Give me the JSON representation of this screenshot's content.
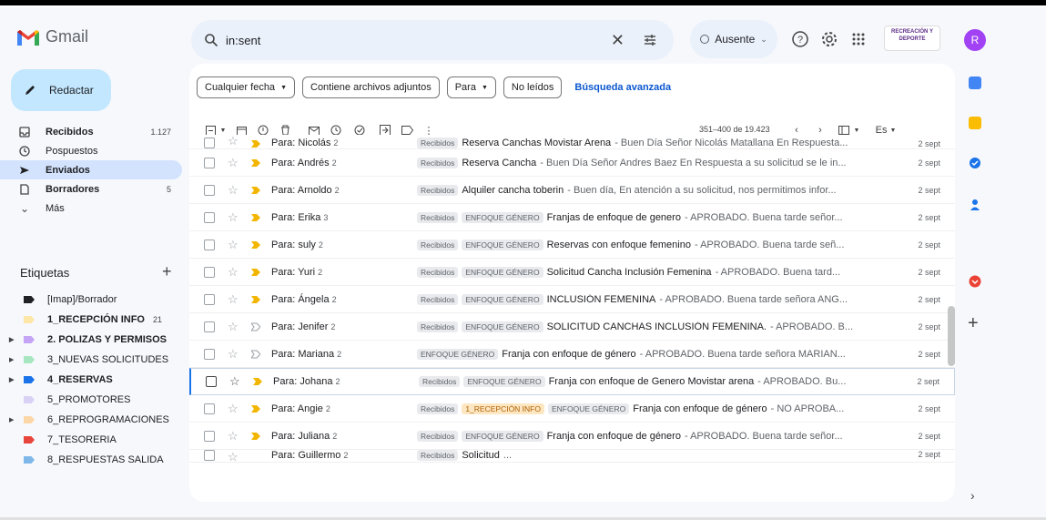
{
  "app": {
    "name": "Gmail"
  },
  "search": {
    "query": "in:sent",
    "clear_icon": "close-icon",
    "filter_icon": "tune-icon"
  },
  "status": {
    "label": "Ausente"
  },
  "header_icons": [
    "help-icon",
    "settings-icon",
    "apps-icon"
  ],
  "org_logo": {
    "text": "RECREACIÓN Y DEPORTE"
  },
  "avatar": {
    "initial": "R",
    "color": "#a142f4"
  },
  "compose": {
    "label": "Redactar"
  },
  "nav": {
    "items": [
      {
        "label": "Recibidos",
        "count": "1.127",
        "icon": "inbox-icon",
        "bold": true
      },
      {
        "label": "Pospuestos",
        "count": "",
        "icon": "clock-icon",
        "bold": false
      },
      {
        "label": "Enviados",
        "count": "",
        "icon": "send-icon",
        "bold": true,
        "active": true
      },
      {
        "label": "Borradores",
        "count": "5",
        "icon": "draft-icon",
        "bold": true
      },
      {
        "label": "Más",
        "count": "",
        "icon": "chevron-down-icon",
        "bold": false
      }
    ]
  },
  "labels": {
    "heading": "Etiquetas",
    "items": [
      {
        "label": "[Imap]/Borrador",
        "color": "#202124",
        "count": "",
        "caret": false,
        "bold": false
      },
      {
        "label": "1_RECEPCIÓN INFO",
        "color": "#fde7a6",
        "count": "21",
        "caret": false,
        "bold": true
      },
      {
        "label": "2. POLIZAS Y PERMISOS",
        "color": "#c5a3f5",
        "count": "",
        "caret": true,
        "bold": true
      },
      {
        "label": "3_NUEVAS SOLICITUDES",
        "color": "#a8e6c1",
        "count": "",
        "caret": true,
        "bold": false
      },
      {
        "label": "4_RESERVAS",
        "color": "#1a73e8",
        "count": "",
        "caret": true,
        "bold": true
      },
      {
        "label": "5_PROMOTORES",
        "color": "#d9d2f5",
        "count": "",
        "caret": false,
        "bold": false
      },
      {
        "label": "6_REPROGRAMACIONES",
        "color": "#fbd7a8",
        "count": "",
        "caret": true,
        "bold": false
      },
      {
        "label": "7_TESORERIA",
        "color": "#e8453c",
        "count": "",
        "caret": false,
        "bold": false
      },
      {
        "label": "8_RESPUESTAS SALIDA",
        "color": "#7fb8e8",
        "count": "",
        "caret": false,
        "bold": false
      }
    ]
  },
  "filters": {
    "chips": [
      "Cualquier fecha",
      "Contiene archivos adjuntos",
      "Para",
      "No leídos"
    ],
    "advanced": "Búsqueda avanzada"
  },
  "toolbar": {
    "pager": "351–400 de 19.423",
    "input_tool": "Es"
  },
  "emails": [
    {
      "from": "Para: Nicolás",
      "count": "2",
      "tags": [
        "Recibidos"
      ],
      "subject": "Reserva Canchas Movistar Arena",
      "snippet": " - Buen Día Señor Nicolás Matallana En Respuesta...",
      "date": "2 sept",
      "cut": true
    },
    {
      "from": "Para: Andrés",
      "count": "2",
      "tags": [
        "Recibidos"
      ],
      "subject": "Reserva Cancha",
      "snippet": " - Buen Día Señor Andres Baez En Respuesta a su solicitud se le in...",
      "date": "2 sept"
    },
    {
      "from": "Para: Arnoldo",
      "count": "2",
      "tags": [
        "Recibidos"
      ],
      "subject": "Alquiler cancha toberin",
      "snippet": " - Buen día, En atención a su solicitud, nos permitimos infor...",
      "date": "2 sept"
    },
    {
      "from": "Para: Erika",
      "count": "3",
      "tags": [
        "Recibidos",
        "ENFOQUE GÉNERO"
      ],
      "subject": "Franjas de enfoque de genero",
      "snippet": " - APROBADO. Buena tarde señor...",
      "date": "2 sept"
    },
    {
      "from": "Para: suly",
      "count": "2",
      "tags": [
        "Recibidos",
        "ENFOQUE GÉNERO"
      ],
      "subject": "Reservas con enfoque femenino",
      "snippet": " - APROBADO. Buena tarde señ...",
      "date": "2 sept"
    },
    {
      "from": "Para: Yuri",
      "count": "2",
      "tags": [
        "Recibidos",
        "ENFOQUE GÉNERO"
      ],
      "subject": "Solicitud Cancha Inclusión Femenina",
      "snippet": " - APROBADO. Buena tard...",
      "date": "2 sept"
    },
    {
      "from": "Para: Ángela",
      "count": "2",
      "tags": [
        "Recibidos",
        "ENFOQUE GÉNERO"
      ],
      "subject": "INCLUSIÓN FEMENINA",
      "snippet": " - APROBADO. Buena tarde señora ANG...",
      "date": "2 sept"
    },
    {
      "from": "Para: Jenifer",
      "count": "2",
      "tags": [
        "Recibidos",
        "ENFOQUE GÉNERO"
      ],
      "subject": "SOLICITUD CANCHAS INCLUSIÓN FEMENINA.",
      "snippet": " - APROBADO. B...",
      "date": "2 sept",
      "imp_off": true
    },
    {
      "from": "Para: Mariana",
      "count": "2",
      "tags": [
        "ENFOQUE GÉNERO"
      ],
      "subject": "Franja con enfoque de género",
      "snippet": " - APROBADO. Buena tarde señora MARIAN...",
      "date": "2 sept",
      "imp_off": true
    },
    {
      "from": "Para: Johana",
      "count": "2",
      "tags": [
        "Recibidos",
        "ENFOQUE GÉNERO"
      ],
      "subject": "Franja con enfoque de Genero Movistar arena",
      "snippet": " - APROBADO. Bu...",
      "date": "2 sept",
      "selected": true
    },
    {
      "from": "Para: Angie",
      "count": "2",
      "tags": [
        "Recibidos",
        "1_RECEPCIÓN INFO",
        "ENFOQUE GÉNERO"
      ],
      "subject": "Franja con enfoque de género",
      "snippet": " - NO APROBA...",
      "date": "2 sept"
    },
    {
      "from": "Para: Juliana",
      "count": "2",
      "tags": [
        "Recibidos",
        "ENFOQUE GÉNERO"
      ],
      "subject": "Franja con enfoque de género",
      "snippet": " - APROBADO. Buena tarde señor...",
      "date": "2 sept"
    },
    {
      "from": "Para: Guillermo",
      "count": "2",
      "tags": [
        "Recibidos"
      ],
      "subject": "Solicitud",
      "snippet": " ...",
      "date": "2 sept",
      "tail": true
    }
  ]
}
